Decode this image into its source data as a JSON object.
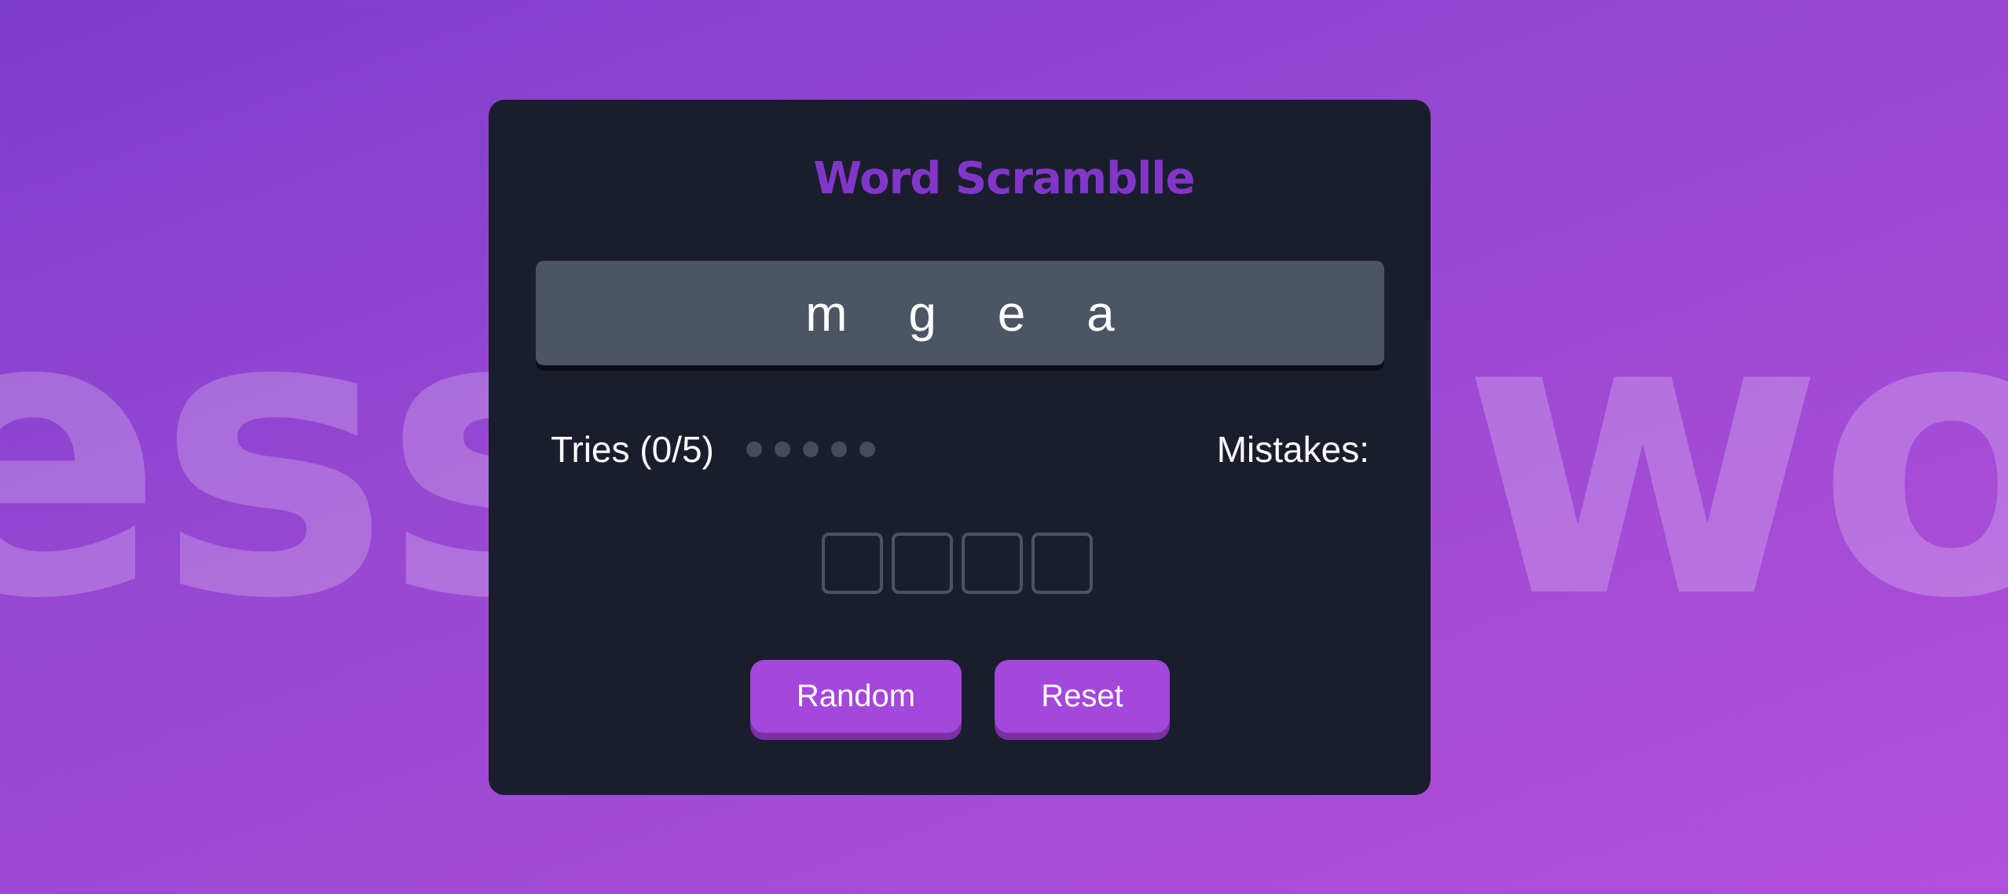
{
  "background": {
    "left_text": "ess",
    "right_text": "wo"
  },
  "game": {
    "title": "Word Scramblle",
    "scrambled_word": "m g e a",
    "tries_label": "Tries (0/5)",
    "tries_used": 0,
    "tries_max": 5,
    "mistakes_label": "Mistakes:",
    "letter_inputs": [
      "",
      "",
      "",
      ""
    ]
  },
  "buttons": {
    "random_label": "Random",
    "reset_label": "Reset"
  },
  "colors": {
    "accent": "#a447dc",
    "title": "#8236c9",
    "card": "#1a1e2c",
    "word_box": "#4b5564"
  }
}
